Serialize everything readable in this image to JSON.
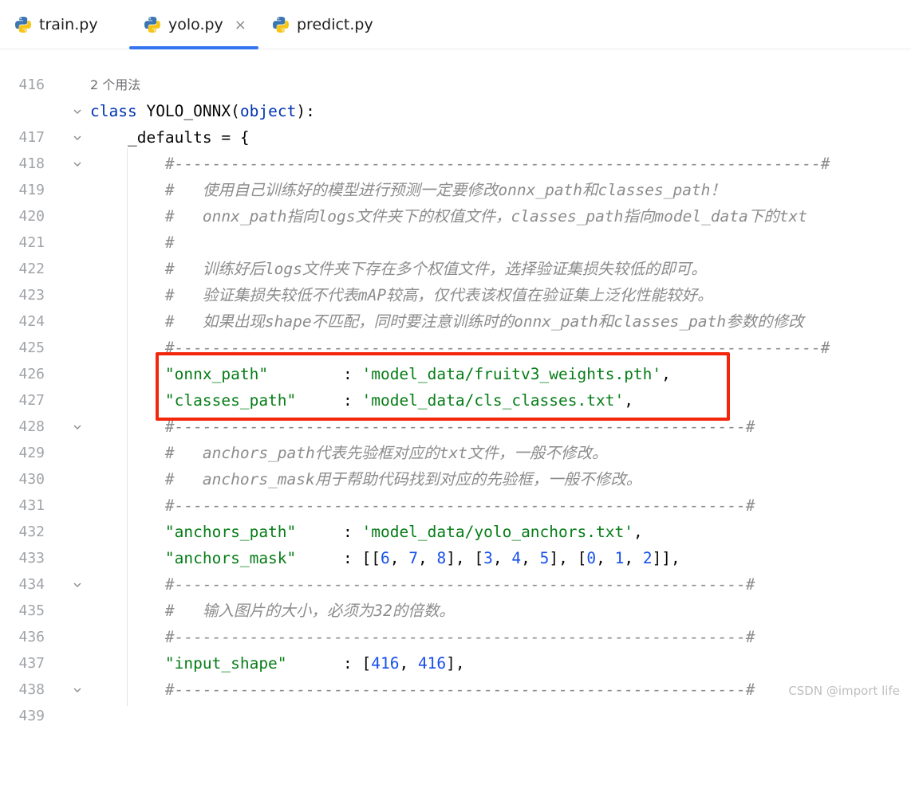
{
  "tabs": [
    {
      "label": "train.py",
      "active": false,
      "icon": "python-file-icon"
    },
    {
      "label": "yolo.py",
      "active": true,
      "icon": "python-file-icon",
      "close": "×"
    },
    {
      "label": "predict.py",
      "active": false,
      "icon": "python-file-icon"
    }
  ],
  "usages_hint": "2 个用法",
  "lines": [
    {
      "n": "416",
      "text": ""
    },
    {
      "n": "417",
      "text": "class YOLO_ONNX(object):"
    },
    {
      "n": "418",
      "text": "    _defaults = {"
    },
    {
      "n": "419",
      "text": "        #---------------------------------------------------------------------#"
    },
    {
      "n": "420",
      "text": "        #   使用自己训练好的模型进行预测一定要修改onnx_path和classes_path！"
    },
    {
      "n": "421",
      "text": "        #   onnx_path指向logs文件夹下的权值文件，classes_path指向model_data下的txt"
    },
    {
      "n": "422",
      "text": "        #"
    },
    {
      "n": "423",
      "text": "        #   训练好后logs文件夹下存在多个权值文件，选择验证集损失较低的即可。"
    },
    {
      "n": "424",
      "text": "        #   验证集损失较低不代表mAP较高，仅代表该权值在验证集上泛化性能较好。"
    },
    {
      "n": "425",
      "text": "        #   如果出现shape不匹配，同时要注意训练时的onnx_path和classes_path参数的修改"
    },
    {
      "n": "426",
      "text": "        #---------------------------------------------------------------------#"
    },
    {
      "n": "427",
      "text": "        \"onnx_path\"        : 'model_data/fruitv3_weights.pth',"
    },
    {
      "n": "428",
      "text": "        \"classes_path\"     : 'model_data/cls_classes.txt',"
    },
    {
      "n": "429",
      "text": "        #-------------------------------------------------------------#"
    },
    {
      "n": "430",
      "text": "        #   anchors_path代表先验框对应的txt文件，一般不修改。"
    },
    {
      "n": "431",
      "text": "        #   anchors_mask用于帮助代码找到对应的先验框，一般不修改。"
    },
    {
      "n": "432",
      "text": "        #-------------------------------------------------------------#"
    },
    {
      "n": "433",
      "text": "        \"anchors_path\"     : 'model_data/yolo_anchors.txt',"
    },
    {
      "n": "434",
      "text": "        \"anchors_mask\"     : [[6, 7, 8], [3, 4, 5], [0, 1, 2]],"
    },
    {
      "n": "435",
      "text": "        #-------------------------------------------------------------#"
    },
    {
      "n": "436",
      "text": "        #   输入图片的大小，必须为32的倍数。"
    },
    {
      "n": "437",
      "text": "        #-------------------------------------------------------------#"
    },
    {
      "n": "438",
      "text": "        \"input_shape\"      : [416, 416],"
    },
    {
      "n": "439",
      "text": "        #-------------------------------------------------------------#"
    }
  ],
  "watermark": "CSDN @import life",
  "colors": {
    "accent": "#3574f0",
    "highlight_box": "#f2260a",
    "keyword": "#0033b3",
    "string": "#067d17",
    "number": "#1750eb",
    "comment": "#8c8c8c"
  }
}
